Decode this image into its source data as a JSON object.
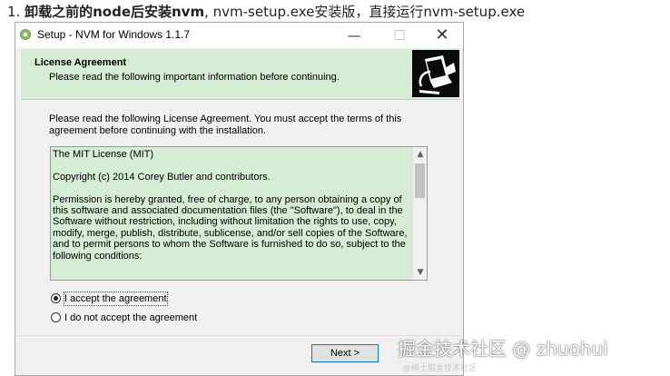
{
  "intro": {
    "num": "1.",
    "bold": "卸载之前的node后安装nvm",
    "rest": ", nvm-setup.exe安装版，直接运行nvm-setup.exe"
  },
  "window": {
    "title": "Setup - NVM for Windows 1.1.7",
    "min_glyph": "—",
    "max_glyph": "☐",
    "close_glyph": "✕"
  },
  "header": {
    "title": "License Agreement",
    "subtitle": "Please read the following important information before continuing."
  },
  "body": {
    "instruction": "Please read the following License Agreement. You must accept the terms of this agreement before continuing with the installation."
  },
  "license": {
    "text": "The MIT License (MIT)\n\nCopyright (c) 2014 Corey Butler and contributors.\n\nPermission is hereby granted, free of charge, to any person obtaining a copy of this software and associated documentation files (the \"Software\"), to deal in the Software without restriction, including without limitation the rights to use, copy, modify, merge, publish, distribute, sublicense, and/or sell copies of the Software, and to permit persons to whom the Software is furnished to do so, subject to the following conditions:",
    "scroll_up": "▲",
    "scroll_down": "▼"
  },
  "options": {
    "accept_label": "I accept the agreement",
    "decline_label": "I do not accept the agreement",
    "selected": "accept"
  },
  "buttons": {
    "next_label": "Next >"
  },
  "watermark": {
    "main": "掘金技术社区 @ zhuohui",
    "sub": "@稀土掘金技术社区"
  },
  "colors": {
    "header_bg": "#d5ecd5",
    "license_bg": "#d5ecd5",
    "button_border": "#0078d7"
  }
}
